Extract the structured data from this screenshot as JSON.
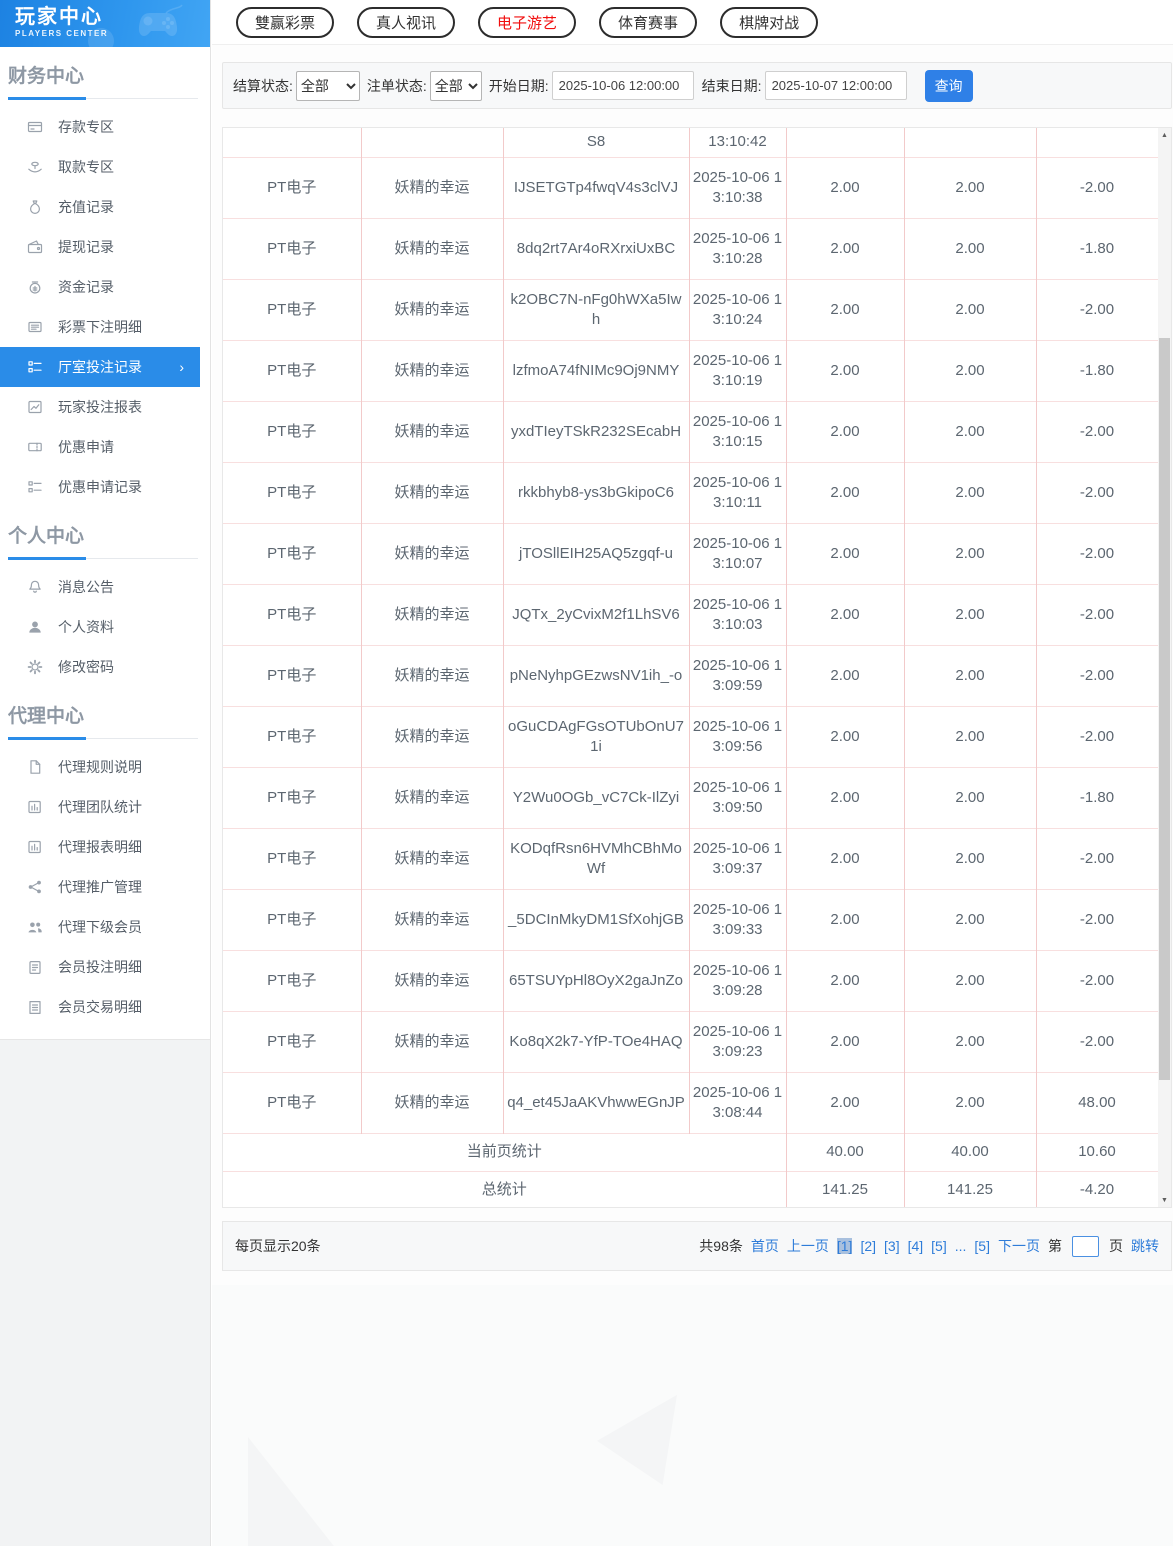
{
  "app": {
    "title": "玩家中心",
    "subtitle": "PLAYERS CENTER"
  },
  "top_tabs": [
    {
      "label": "雙赢彩票",
      "active": false
    },
    {
      "label": "真人视讯",
      "active": false
    },
    {
      "label": "电子游艺",
      "active": true
    },
    {
      "label": "体育赛事",
      "active": false
    },
    {
      "label": "棋牌对战",
      "active": false
    }
  ],
  "sidebar": {
    "sections": [
      {
        "title": "财务中心",
        "items": [
          {
            "icon": "deposit-card-icon",
            "label": "存款专区"
          },
          {
            "icon": "withdraw-hand-icon",
            "label": "取款专区"
          },
          {
            "icon": "moneybag-icon",
            "label": "充值记录"
          },
          {
            "icon": "wallet-icon",
            "label": "提现记录"
          },
          {
            "icon": "funds-icon",
            "label": "资金记录"
          },
          {
            "icon": "newspaper-icon",
            "label": "彩票下注明细"
          },
          {
            "icon": "hall-record-icon",
            "label": "厅室投注记录",
            "active": true,
            "chevron": "›"
          },
          {
            "icon": "report-chart-icon",
            "label": "玩家投注报表"
          },
          {
            "icon": "ticket-icon",
            "label": "优惠申请"
          },
          {
            "icon": "list-record-icon",
            "label": "优惠申请记录"
          }
        ]
      },
      {
        "title": "个人中心",
        "items": [
          {
            "icon": "bell-icon",
            "label": "消息公告"
          },
          {
            "icon": "person-icon",
            "label": "个人资料"
          },
          {
            "icon": "gear-icon",
            "label": "修改密码"
          }
        ]
      },
      {
        "title": "代理中心",
        "items": [
          {
            "icon": "file-icon",
            "label": "代理规则说明"
          },
          {
            "icon": "board-chart-icon",
            "label": "代理团队统计"
          },
          {
            "icon": "board-chart-icon",
            "label": "代理报表明细"
          },
          {
            "icon": "share-icon",
            "label": "代理推广管理"
          },
          {
            "icon": "users-icon",
            "label": "代理下级会员"
          },
          {
            "icon": "clipboard-icon",
            "label": "会员投注明细"
          },
          {
            "icon": "clipboard2-icon",
            "label": "会员交易明细"
          }
        ]
      }
    ]
  },
  "filters": {
    "settle_status_label": "结算状态:",
    "settle_status_value": "全部",
    "order_status_label": "注单状态:",
    "order_status_value": "全部",
    "start_date_label": "开始日期:",
    "start_date_value": "2025-10-06 12:00:00",
    "end_date_label": "结束日期:",
    "end_date_value": "2025-10-07 12:00:00",
    "query_label": "查询"
  },
  "table": {
    "partial_row": {
      "order_id": "S8",
      "time": "13:10:42"
    },
    "rows": [
      {
        "provider": "PT电子",
        "game": "妖精的幸运",
        "order_id": "IJSETGTp4fwqV4s3clVJ",
        "time": "2025-10-06 13:10:38",
        "bet": "2.00",
        "valid": "2.00",
        "winloss": "-2.00"
      },
      {
        "provider": "PT电子",
        "game": "妖精的幸运",
        "order_id": "8dq2rt7Ar4oRXrxiUxBC",
        "time": "2025-10-06 13:10:28",
        "bet": "2.00",
        "valid": "2.00",
        "winloss": "-1.80"
      },
      {
        "provider": "PT电子",
        "game": "妖精的幸运",
        "order_id": "k2OBC7N-nFg0hWXa5Iwh",
        "time": "2025-10-06 13:10:24",
        "bet": "2.00",
        "valid": "2.00",
        "winloss": "-2.00"
      },
      {
        "provider": "PT电子",
        "game": "妖精的幸运",
        "order_id": "lzfmoA74fNIMc9Oj9NMY",
        "time": "2025-10-06 13:10:19",
        "bet": "2.00",
        "valid": "2.00",
        "winloss": "-1.80"
      },
      {
        "provider": "PT电子",
        "game": "妖精的幸运",
        "order_id": "yxdTIeyTSkR232SEcabH",
        "time": "2025-10-06 13:10:15",
        "bet": "2.00",
        "valid": "2.00",
        "winloss": "-2.00"
      },
      {
        "provider": "PT电子",
        "game": "妖精的幸运",
        "order_id": "rkkbhyb8-ys3bGkipoC6",
        "time": "2025-10-06 13:10:11",
        "bet": "2.00",
        "valid": "2.00",
        "winloss": "-2.00"
      },
      {
        "provider": "PT电子",
        "game": "妖精的幸运",
        "order_id": "jTOSllEIH25AQ5zgqf-u",
        "time": "2025-10-06 13:10:07",
        "bet": "2.00",
        "valid": "2.00",
        "winloss": "-2.00"
      },
      {
        "provider": "PT电子",
        "game": "妖精的幸运",
        "order_id": "JQTx_2yCvixM2f1LhSV6",
        "time": "2025-10-06 13:10:03",
        "bet": "2.00",
        "valid": "2.00",
        "winloss": "-2.00"
      },
      {
        "provider": "PT电子",
        "game": "妖精的幸运",
        "order_id": "pNeNyhpGEzwsNV1ih_-o",
        "time": "2025-10-06 13:09:59",
        "bet": "2.00",
        "valid": "2.00",
        "winloss": "-2.00"
      },
      {
        "provider": "PT电子",
        "game": "妖精的幸运",
        "order_id": "oGuCDAgFGsOTUbOnU71i",
        "time": "2025-10-06 13:09:56",
        "bet": "2.00",
        "valid": "2.00",
        "winloss": "-2.00"
      },
      {
        "provider": "PT电子",
        "game": "妖精的幸运",
        "order_id": "Y2Wu0OGb_vC7Ck-IlZyi",
        "time": "2025-10-06 13:09:50",
        "bet": "2.00",
        "valid": "2.00",
        "winloss": "-1.80"
      },
      {
        "provider": "PT电子",
        "game": "妖精的幸运",
        "order_id": "KODqfRsn6HVMhCBhMoWf",
        "time": "2025-10-06 13:09:37",
        "bet": "2.00",
        "valid": "2.00",
        "winloss": "-2.00"
      },
      {
        "provider": "PT电子",
        "game": "妖精的幸运",
        "order_id": "_5DCInMkyDM1SfXohjGB",
        "time": "2025-10-06 13:09:33",
        "bet": "2.00",
        "valid": "2.00",
        "winloss": "-2.00"
      },
      {
        "provider": "PT电子",
        "game": "妖精的幸运",
        "order_id": "65TSUYpHl8OyX2gaJnZo",
        "time": "2025-10-06 13:09:28",
        "bet": "2.00",
        "valid": "2.00",
        "winloss": "-2.00"
      },
      {
        "provider": "PT电子",
        "game": "妖精的幸运",
        "order_id": "Ko8qX2k7-YfP-TOe4HAQ",
        "time": "2025-10-06 13:09:23",
        "bet": "2.00",
        "valid": "2.00",
        "winloss": "-2.00"
      },
      {
        "provider": "PT电子",
        "game": "妖精的幸运",
        "order_id": "q4_et45JaAKVhwwEGnJP",
        "time": "2025-10-06 13:08:44",
        "bet": "2.00",
        "valid": "2.00",
        "winloss": "48.00"
      }
    ],
    "summary_rows": [
      {
        "label": "当前页统计",
        "bet": "40.00",
        "valid": "40.00",
        "winloss": "10.60"
      },
      {
        "label": "总统计",
        "bet": "141.25",
        "valid": "141.25",
        "winloss": "-4.20"
      }
    ]
  },
  "pagination": {
    "page_size_text": "每页显示20条",
    "total_text": "共98条",
    "first_label": "首页",
    "prev_label": "上一页",
    "pages": [
      {
        "label": "[1]",
        "current": true
      },
      {
        "label": "[2]",
        "current": false
      },
      {
        "label": "[3]",
        "current": false
      },
      {
        "label": "[4]",
        "current": false
      },
      {
        "label": "[5]",
        "current": false
      },
      {
        "label": "...",
        "current": false
      },
      {
        "label": "[5]",
        "current": false
      }
    ],
    "next_label": "下一页",
    "jump_prefix": "第",
    "jump_suffix": "页",
    "jump_label": "跳转",
    "jump_value": ""
  },
  "colors": {
    "accent_blue": "#2a8ce8",
    "active_tab_red": "#f10e0e",
    "link_blue": "#2e7cd9",
    "table_border_pink": "#f2caca"
  }
}
